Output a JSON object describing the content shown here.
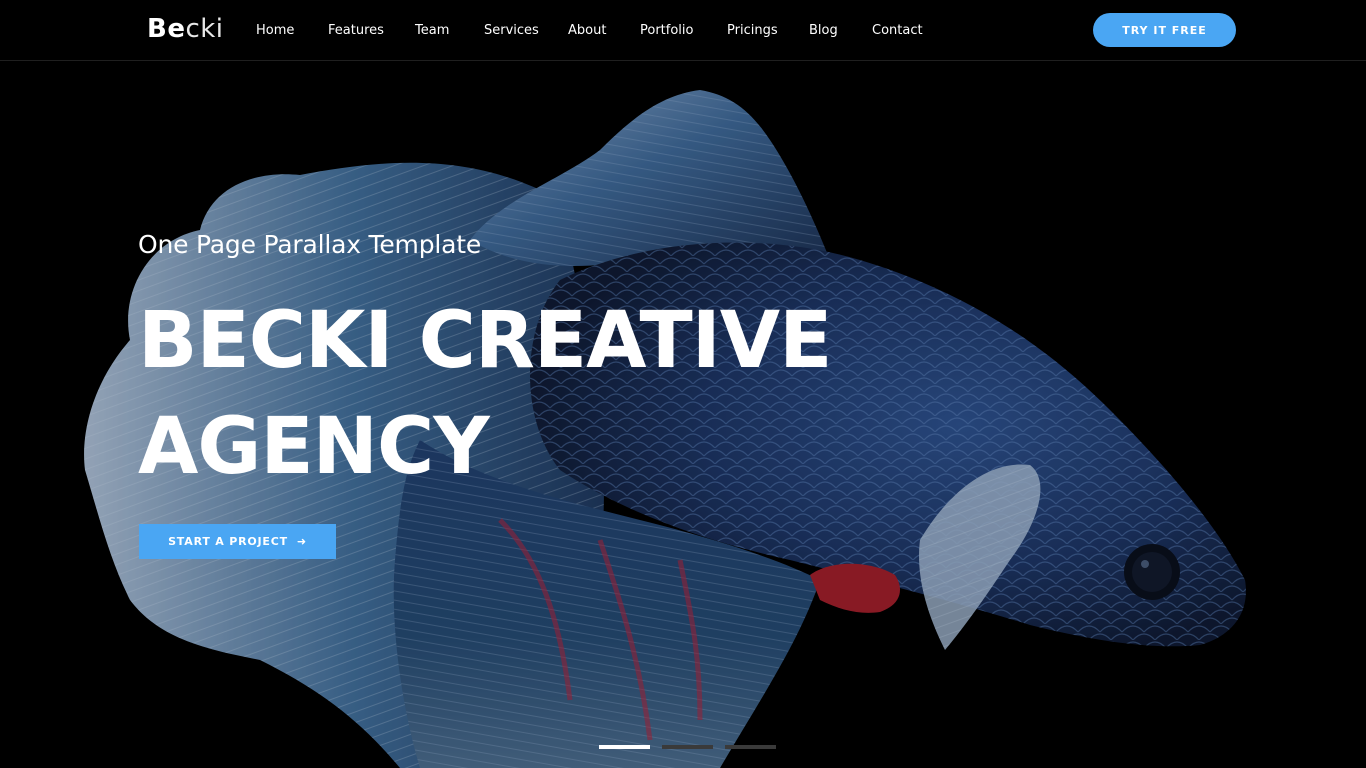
{
  "header": {
    "logo_bold": "Be",
    "logo_light": "cki",
    "nav": [
      {
        "label": "Home"
      },
      {
        "label": "Features"
      },
      {
        "label": "Team"
      },
      {
        "label": "Services"
      },
      {
        "label": "About"
      },
      {
        "label": "Portfolio"
      },
      {
        "label": "Pricings"
      },
      {
        "label": "Blog"
      },
      {
        "label": "Contact"
      }
    ],
    "cta_label": "TRY IT FREE"
  },
  "hero": {
    "subtitle": "One Page Parallax Template",
    "headline_line1": "BECKI CREATIVE",
    "headline_line2": "AGENCY",
    "cta_label": "START A PROJECT",
    "cta_icon": "arrow-right-icon",
    "slides": [
      {
        "active": true
      },
      {
        "active": false
      },
      {
        "active": false
      }
    ]
  },
  "colors": {
    "accent": "#4aa6f3",
    "background": "#000000",
    "text": "#ffffff"
  }
}
